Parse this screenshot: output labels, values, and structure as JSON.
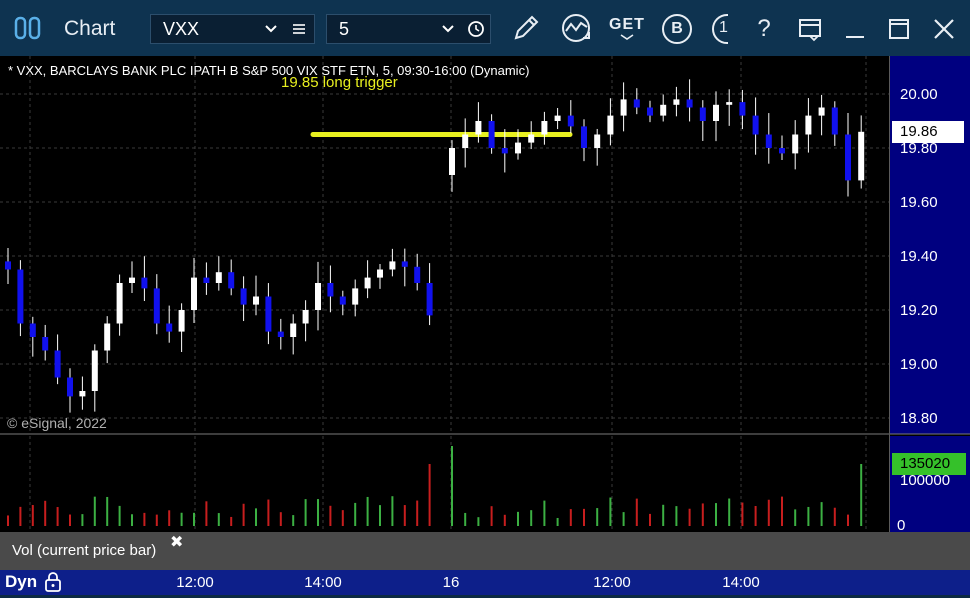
{
  "window": {
    "title": "Chart",
    "symbol": "VXX",
    "interval": "5",
    "get_label": "GET",
    "b_label": "B",
    "one_label": "1",
    "help_label": "?"
  },
  "chart": {
    "header": "* VXX, BARCLAYS BANK PLC IPATH B S&P 500 VIX STF ETN, 5, 09:30-16:00 (Dynamic)",
    "annotation": "19.85 long trigger",
    "copyright": "© eSignal, 2022",
    "price_axis": [
      "20.00",
      "19.80",
      "19.60",
      "19.40",
      "19.20",
      "19.00",
      "18.80"
    ],
    "last_price": "19.86",
    "volume_axis": [
      "100000",
      "0"
    ],
    "last_volume": "135020",
    "volume_study_label": "Vol (current price bar)",
    "close_glyph": "✖",
    "time_axis": [
      "12:00",
      "14:00",
      "16",
      "12:00",
      "14:00"
    ],
    "mode_label": "Dyn"
  },
  "colors": {
    "up_candle": "#ffffff",
    "down_candle": "#1111ee",
    "trigger_line": "#e8f020",
    "vol_up": "#3cb043",
    "vol_down": "#c81e1e",
    "last_volume_bg": "#35c12a",
    "bottom_bar": "#0d1f8a"
  },
  "chart_data": {
    "type": "candlestick",
    "price_range": [
      18.8,
      20.0
    ],
    "trigger_level": 19.85,
    "day1_closes": [
      19.35,
      19.15,
      19.1,
      19.05,
      18.95,
      18.88,
      18.9,
      19.05,
      19.15,
      19.3,
      19.32,
      19.28,
      19.15,
      19.12,
      19.2,
      19.32,
      19.3,
      19.34,
      19.28,
      19.22,
      19.25,
      19.12,
      19.1,
      19.15,
      19.2,
      19.3,
      19.25,
      19.22,
      19.28,
      19.32,
      19.35,
      19.38,
      19.36,
      19.3,
      19.18
    ],
    "day2_closes": [
      19.8,
      19.85,
      19.9,
      19.8,
      19.78,
      19.82,
      19.85,
      19.9,
      19.92,
      19.88,
      19.8,
      19.85,
      19.92,
      19.98,
      19.95,
      19.92,
      19.96,
      19.98,
      19.95,
      19.9,
      19.96,
      19.97,
      19.92,
      19.85,
      19.8,
      19.78,
      19.85,
      19.92,
      19.95,
      19.85,
      19.68,
      19.86
    ],
    "volume_range": [
      0,
      135020
    ]
  }
}
